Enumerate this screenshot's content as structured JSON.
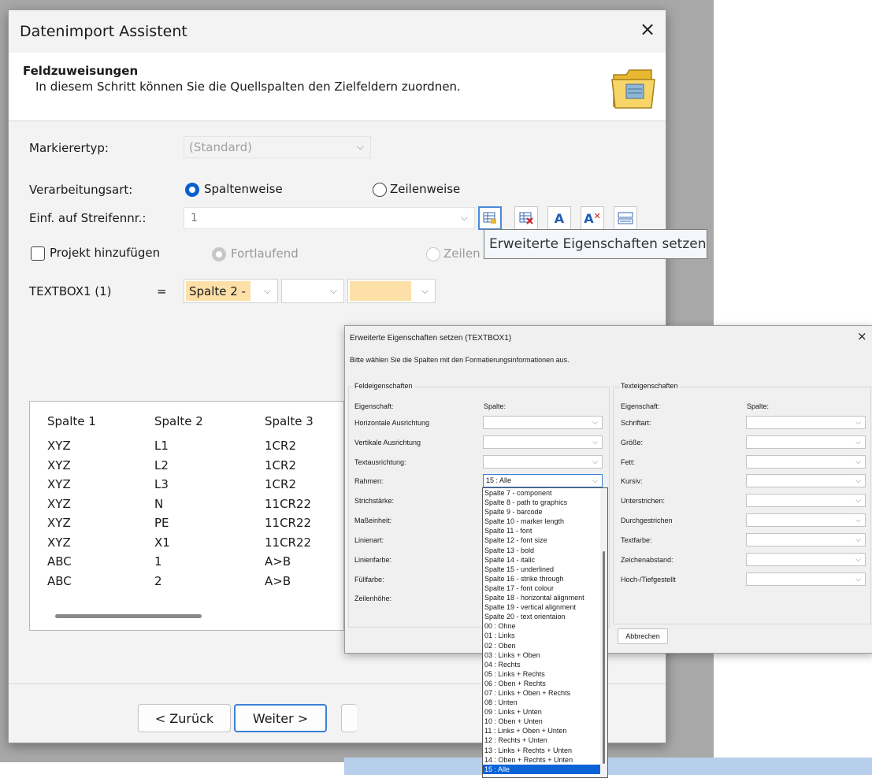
{
  "window": {
    "title": "Datenimport Assistent",
    "close": "×"
  },
  "header": {
    "title": "Feldzuweisungen",
    "subtitle": "In diesem Schritt können Sie die Quellspalten den Zielfeldern zuordnen."
  },
  "form": {
    "markierertyp_label": "Markierertyp:",
    "markierertyp_value": "(Standard)",
    "verarbeitungsart_label": "Verarbeitungsart:",
    "opt_spaltenweise": "Spaltenweise",
    "opt_zeilenweise": "Zeilenweise",
    "streifen_label": "Einf. auf Streifennr.:",
    "streifen_value": "1",
    "projekt_label": "Projekt hinzufügen",
    "opt_fortlaufend": "Fortlaufend",
    "opt_zeilen": "Zeilen",
    "textbox_label": "TEXTBOX1 (1)",
    "equals": "=",
    "field1_value": "Spalte 2 -"
  },
  "tooltip": "Erweiterte Eigenschaften setzen",
  "grid": {
    "headers": [
      "Spalte 1",
      "Spalte 2",
      "Spalte 3"
    ],
    "rows": [
      [
        "XYZ",
        "L1",
        "1CR2"
      ],
      [
        "XYZ",
        "L2",
        "1CR2"
      ],
      [
        "XYZ",
        "L3",
        "1CR2"
      ],
      [
        "XYZ",
        "N",
        "11CR22"
      ],
      [
        "XYZ",
        "PE",
        "11CR22"
      ],
      [
        "XYZ",
        "X1",
        "11CR22"
      ],
      [
        "ABC",
        "1",
        "A>B"
      ],
      [
        "ABC",
        "2",
        "A>B"
      ]
    ]
  },
  "buttons": {
    "back": "< Zurück",
    "next": "Weiter >"
  },
  "dialog": {
    "title": "Erweiterte Eigenschaften setzen (TEXTBOX1)",
    "close": "×",
    "instruction": "Bitte wählen Sie die Spalten mit den Formatierungsinformationen aus.",
    "group_field": "Feldeigenschaften",
    "group_text": "Texteigenschaften",
    "col_eigenschaft": "Eigenschaft:",
    "col_spalte": "Spalte:",
    "field_props": [
      "Horizontale Ausrichtung",
      "Vertikale Ausrichtung",
      "Textausrichtung:",
      "Rahmen:",
      "Strichstärke:",
      "Maßeinheit:",
      "Linienart:",
      "Linienfarbe:",
      "Füllfarbe:",
      "Zeilenhöhe:"
    ],
    "rahmen_value": "15 : Alle",
    "text_props": [
      "Schriftart:",
      "Größe:",
      "Fett:",
      "Kursiv:",
      "Unterstrichen:",
      "Durchgestrichen",
      "Textfarbe:",
      "Zeichenabstand:",
      "Hoch-/Tiefgestellt"
    ],
    "cancel": "Abbrechen"
  },
  "dropdown_items": [
    "Spalte 7 - component",
    "Spalte 8 - path to graphics",
    "Spalte 9 - barcode",
    "Spalte 10 - marker length",
    "Spalte 11 - font",
    "Spalte 12 - font size",
    "Spalte 13 - bold",
    "Spalte 14 - italic",
    "Spalte 15 - underlined",
    "Spalte 16 - strike through",
    "Spalte 17 - font colour",
    "Spalte 18 - horizontal alignment",
    "Spalte 19 - vertical alignment",
    "Spalte 20 - text orientaion",
    "00 : Ohne",
    "01 : Links",
    "02 : Oben",
    "03 : Links + Oben",
    "04 : Rechts",
    "05 : Links + Rechts",
    "06 : Oben + Rechts",
    "07 : Links + Oben + Rechts",
    "08 : Unten",
    "09 : Links + Unten",
    "10 : Oben + Unten",
    "11 : Links + Oben + Unten",
    "12 : Rechts + Unten",
    "13 : Links + Rechts + Unten",
    "14 : Oben + Rechts + Unten",
    "15 : Alle"
  ],
  "dropdown_selected": "15 : Alle"
}
